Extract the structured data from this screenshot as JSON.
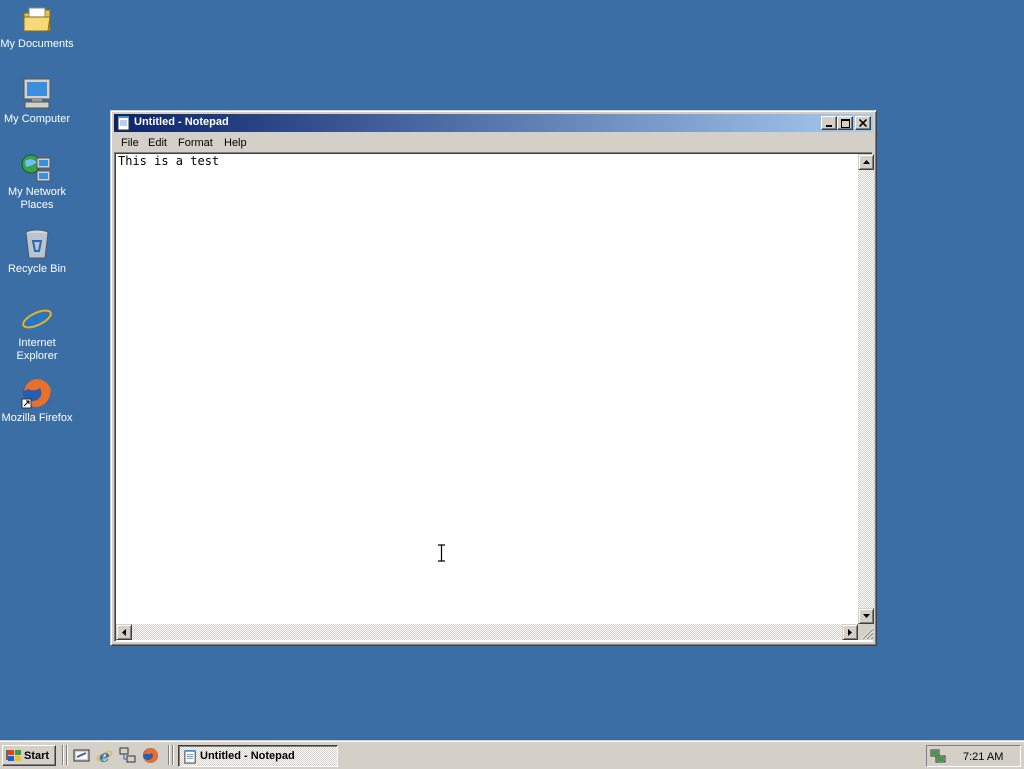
{
  "desktop": {
    "icons": [
      {
        "label": "My Documents",
        "icon": "folder-documents-icon"
      },
      {
        "label": "My Computer",
        "icon": "computer-icon"
      },
      {
        "label": "My Network Places",
        "icon": "network-places-icon"
      },
      {
        "label": "Recycle Bin",
        "icon": "recycle-bin-icon"
      },
      {
        "label": "Internet Explorer",
        "icon": "internet-explorer-icon"
      },
      {
        "label": "Mozilla Firefox",
        "icon": "firefox-icon"
      }
    ],
    "background_color": "#3a6ea5"
  },
  "window": {
    "title": "Untitled - Notepad",
    "menu": [
      "File",
      "Edit",
      "Format",
      "Help"
    ],
    "content": "This is a test",
    "titlebar_colors": [
      "#0a246a",
      "#a6caf0"
    ]
  },
  "taskbar": {
    "start_label": "Start",
    "quick_launch": [
      "show-desktop-icon",
      "internet-explorer-icon",
      "network-icon",
      "firefox-icon"
    ],
    "task_button_label": "Untitled - Notepad",
    "clock": "7:21 AM"
  }
}
